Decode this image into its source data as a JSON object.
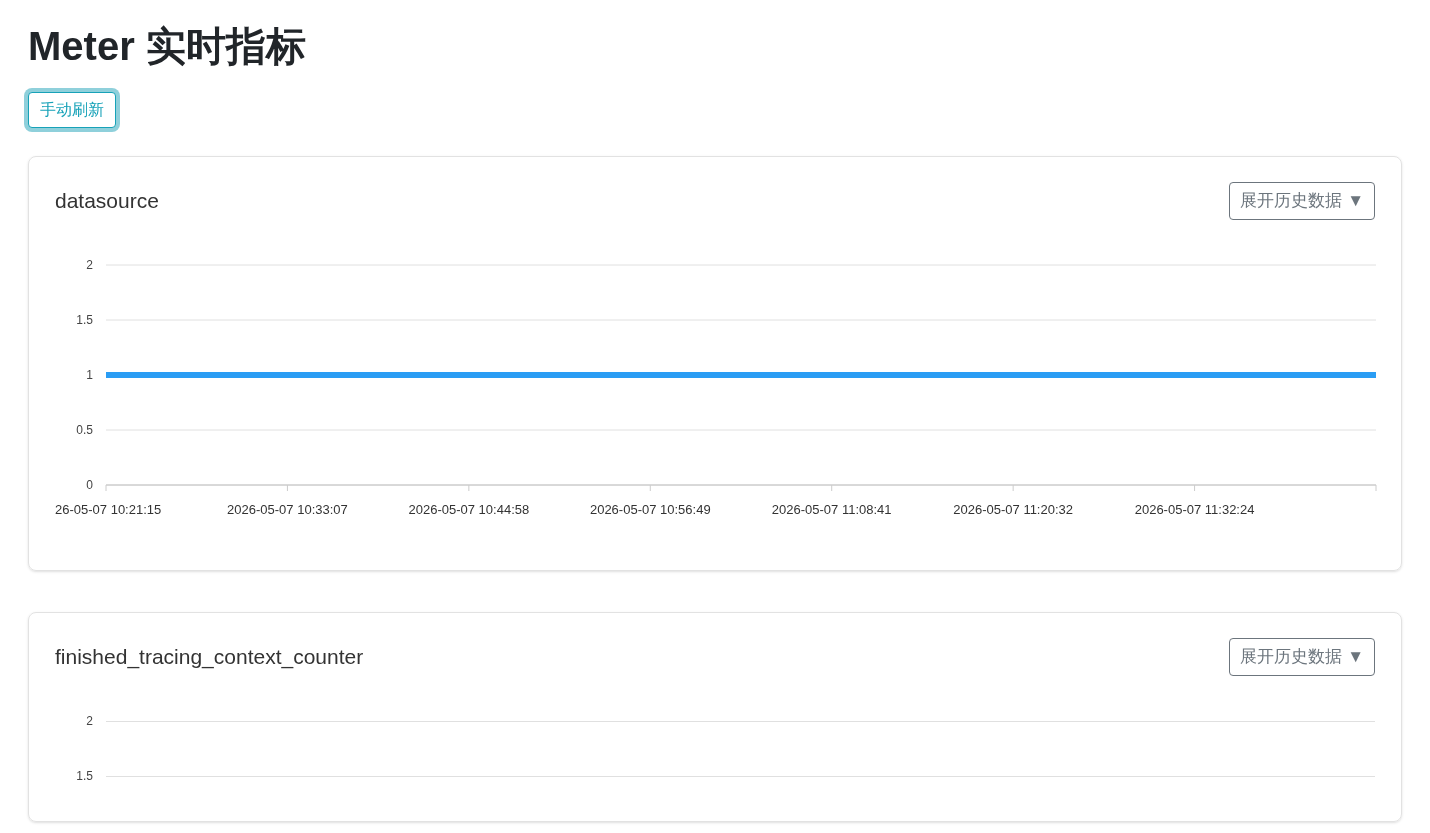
{
  "page": {
    "title": "Meter 实时指标"
  },
  "refresh_button": {
    "label": "手动刷新",
    "focused": true
  },
  "cards": [
    {
      "title": "datasource",
      "toggle": "展开历史数据 ▼",
      "chart_data": {
        "type": "line",
        "categories": [
          "26-05-07 10:21:15",
          "2026-05-07 10:33:07",
          "2026-05-07 10:44:58",
          "2026-05-07 10:56:49",
          "2026-05-07 11:08:41",
          "2026-05-07 11:20:32",
          "2026-05-07 11:32:24",
          null
        ],
        "series": [
          {
            "color": "#2a9df4",
            "values": [
              1,
              1,
              1,
              1,
              1,
              1,
              1,
              1
            ]
          }
        ],
        "ylim": [
          0,
          2
        ],
        "yticks": [
          0,
          0.5,
          1,
          1.5,
          2
        ]
      }
    },
    {
      "title": "finished_tracing_context_counter",
      "toggle": "展开历史数据 ▼",
      "y_axis_labels": [
        "2",
        "1.5"
      ]
    }
  ]
}
